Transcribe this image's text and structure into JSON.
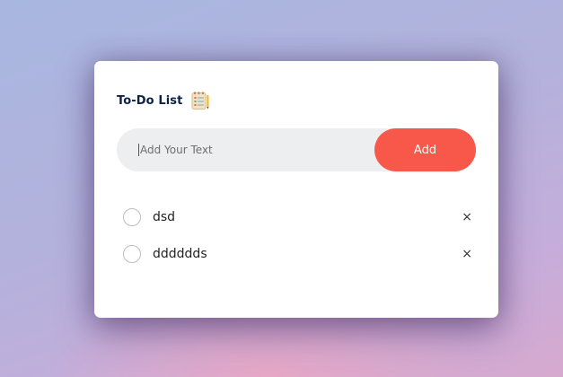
{
  "app": {
    "title": "To-Do List",
    "title_icon": "notepad-icon"
  },
  "input": {
    "placeholder": "Add Your Text",
    "value": ""
  },
  "add_button": {
    "label": "Add",
    "color": "#f7584a"
  },
  "tasks": [
    {
      "text": "dsd",
      "checked": false,
      "delete_label": "×"
    },
    {
      "text": "dddddds",
      "checked": false,
      "delete_label": "×"
    }
  ],
  "colors": {
    "title": "#0a2346",
    "input_background": "#edeef0",
    "card": "#ffffff"
  }
}
